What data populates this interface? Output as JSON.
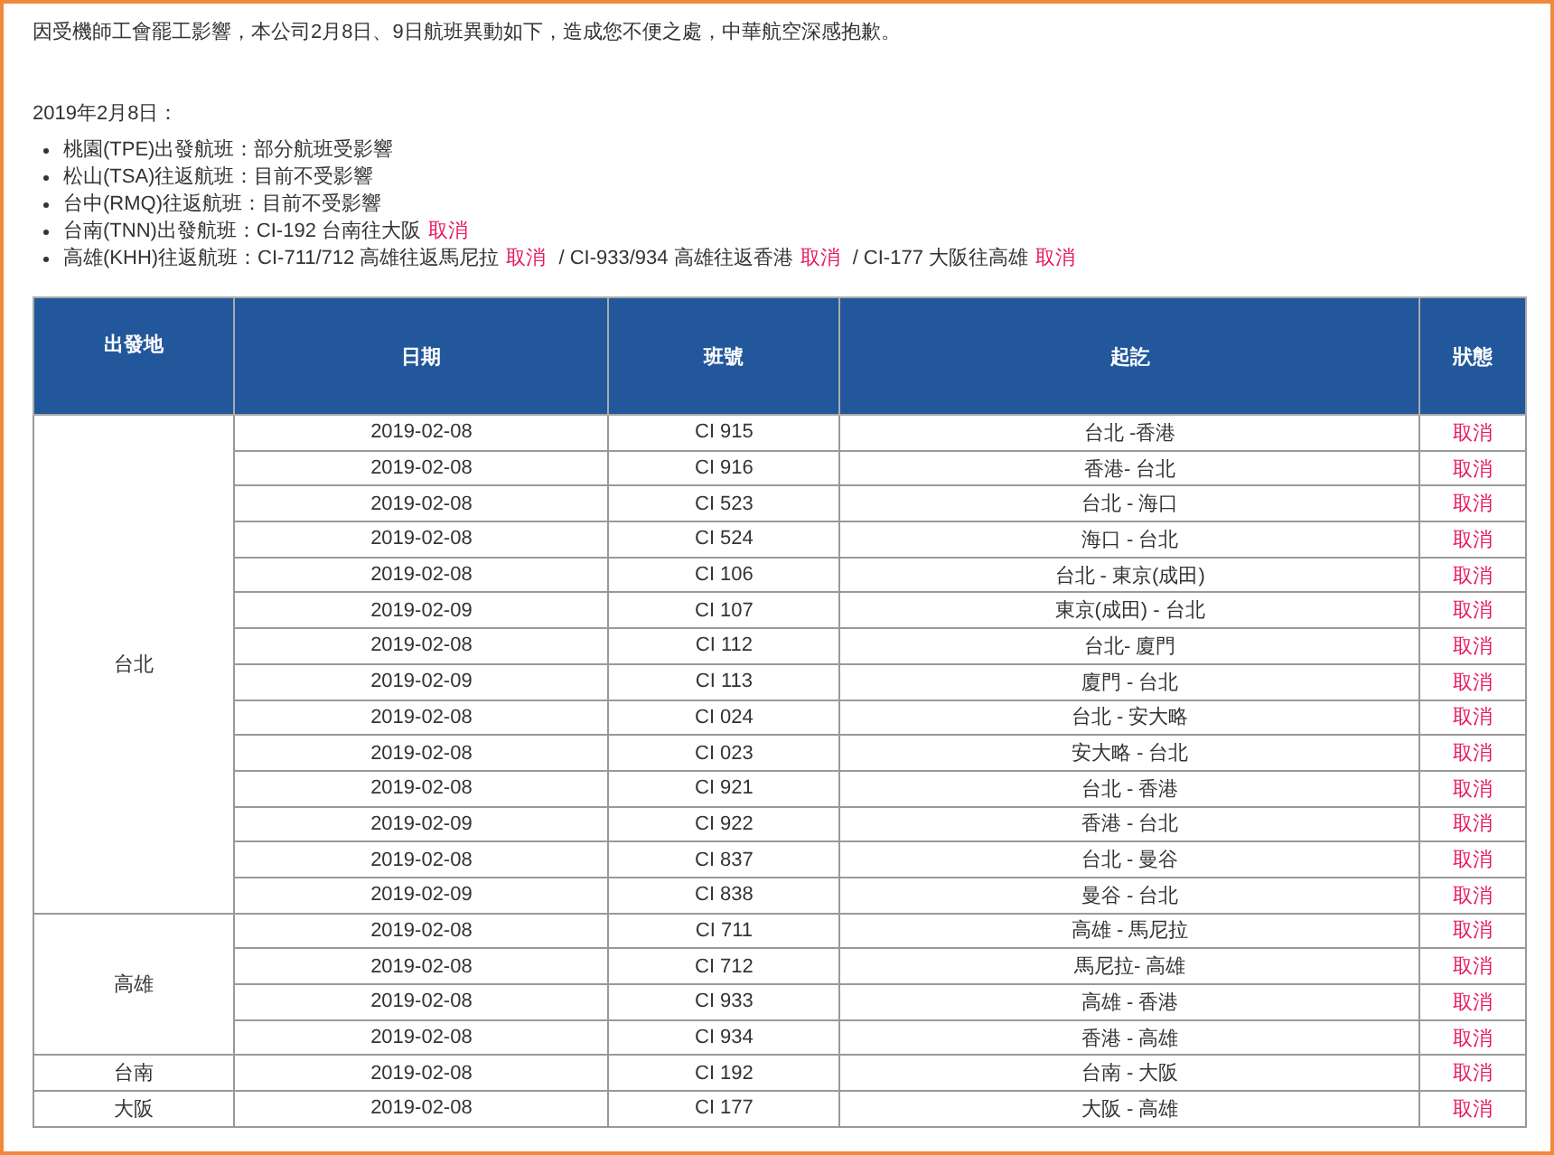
{
  "notice": "因受機師工會罷工影響，本公司2月8日、9日航班異動如下，造成您不便之處，中華航空深感抱歉。",
  "date_heading": "2019年2月8日：",
  "bullets": [
    [
      {
        "kind": "plain",
        "text": "桃園(TPE)出發航班：部分航班受影響"
      }
    ],
    [
      {
        "kind": "plain",
        "text": "松山(TSA)往返航班：目前不受影響"
      }
    ],
    [
      {
        "kind": "plain",
        "text": "台中(RMQ)往返航班：目前不受影響"
      }
    ],
    [
      {
        "kind": "plain",
        "text": "台南(TNN)出發航班：CI-192 台南往大阪"
      },
      {
        "kind": "cancel",
        "text": "取消"
      }
    ],
    [
      {
        "kind": "plain",
        "text": "高雄(KHH)往返航班：CI-711/712 高雄往返馬尼拉"
      },
      {
        "kind": "cancel",
        "text": "取消"
      },
      {
        "kind": "plain",
        "text": "/ CI-933/934 高雄往返香港"
      },
      {
        "kind": "cancel",
        "text": "取消"
      },
      {
        "kind": "plain",
        "text": "/ CI-177 大阪往高雄"
      },
      {
        "kind": "cancel",
        "text": "取消"
      }
    ]
  ],
  "table": {
    "columns": [
      "出發地",
      "日期",
      "班號",
      "起訖",
      "狀態"
    ],
    "groups": [
      {
        "origin": "台北",
        "rows": [
          {
            "date": "2019-02-08",
            "flight": "CI 915",
            "route": "台北 -香港",
            "status": "取消",
            "kind": "cancel"
          },
          {
            "date": "2019-02-08",
            "flight": "CI 916",
            "route": "香港- 台北",
            "status": "取消",
            "kind": "cancel"
          },
          {
            "date": "2019-02-08",
            "flight": "CI 523",
            "route": "台北 - 海口",
            "status": "取消",
            "kind": "cancel"
          },
          {
            "date": "2019-02-08",
            "flight": "CI 524",
            "route": "海口 - 台北",
            "status": "取消",
            "kind": "cancel"
          },
          {
            "date": "2019-02-08",
            "flight": "CI 106",
            "route": "台北 - 東京(成田)",
            "status": "取消",
            "kind": "cancel"
          },
          {
            "date": "2019-02-09",
            "flight": "CI 107",
            "route": "東京(成田) - 台北",
            "status": "取消",
            "kind": "cancel"
          },
          {
            "date": "2019-02-08",
            "flight": "CI 112",
            "route": "台北- 廈門",
            "status": "取消",
            "kind": "cancel"
          },
          {
            "date": "2019-02-09",
            "flight": "CI 113",
            "route": "廈門 - 台北",
            "status": "取消",
            "kind": "cancel"
          },
          {
            "date": "2019-02-08",
            "flight": "CI 024",
            "route": "台北 - 安大略",
            "status": "取消",
            "kind": "cancel"
          },
          {
            "date": "2019-02-08",
            "flight": "CI 023",
            "route": "安大略 - 台北",
            "status": "取消",
            "kind": "cancel"
          },
          {
            "date": "2019-02-08",
            "flight": "CI 921",
            "route": "台北 - 香港",
            "status": "取消",
            "kind": "cancel"
          },
          {
            "date": "2019-02-09",
            "flight": "CI 922",
            "route": "香港 - 台北",
            "status": "取消",
            "kind": "cancel"
          },
          {
            "date": "2019-02-08",
            "flight": "CI 837",
            "route": "台北 - 曼谷",
            "status": "取消",
            "kind": "cancel"
          },
          {
            "date": "2019-02-09",
            "flight": "CI 838",
            "route": "曼谷 - 台北",
            "status": "取消",
            "kind": "cancel"
          }
        ]
      },
      {
        "origin": "高雄",
        "rows": [
          {
            "date": "2019-02-08",
            "flight": "CI 711",
            "route": "高雄 - 馬尼拉",
            "status": "取消",
            "kind": "cancel"
          },
          {
            "date": "2019-02-08",
            "flight": "CI 712",
            "route": "馬尼拉- 高雄",
            "status": "取消",
            "kind": "cancel"
          },
          {
            "date": "2019-02-08",
            "flight": "CI 933",
            "route": "高雄 - 香港",
            "status": "取消",
            "kind": "cancel"
          },
          {
            "date": "2019-02-08",
            "flight": "CI 934",
            "route": "香港 - 高雄",
            "status": "取消",
            "kind": "cancel"
          }
        ]
      },
      {
        "origin": "台南",
        "rows": [
          {
            "date": "2019-02-08",
            "flight": "CI 192",
            "route": "台南 - 大阪",
            "status": "取消",
            "kind": "cancel"
          }
        ]
      },
      {
        "origin": "大阪",
        "rows": [
          {
            "date": "2019-02-08",
            "flight": "CI 177",
            "route": "大阪 - 高雄",
            "status": "取消",
            "kind": "cancel"
          }
        ]
      }
    ]
  }
}
